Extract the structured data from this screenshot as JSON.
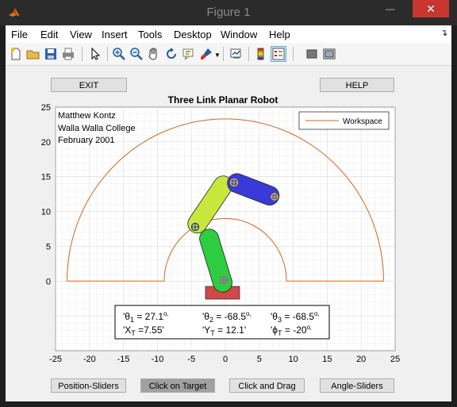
{
  "window": {
    "title": "Figure 1",
    "minimize_glyph": "—",
    "maximize_glyph": "□",
    "close_glyph": "✕"
  },
  "menu": [
    "File",
    "Edit",
    "View",
    "Insert",
    "Tools",
    "Desktop",
    "Window",
    "Help"
  ],
  "toolbar_icons": [
    "new-figure-icon",
    "open-file-icon",
    "save-icon",
    "print-icon",
    "pointer-icon",
    "zoom-in-icon",
    "zoom-out-icon",
    "pan-icon",
    "rotate-icon",
    "data-cursor-icon",
    "brush-icon",
    "link-plot-icon",
    "colorbar-icon",
    "legend-icon",
    "hide-plot-tools-icon",
    "show-plot-tools-icon"
  ],
  "buttons": {
    "exit": "EXIT",
    "help": "HELP",
    "position_sliders": "Position-Sliders",
    "click_on_target": "Click on Target",
    "click_and_drag": "Click and Drag",
    "angle_sliders": "Angle-Sliders"
  },
  "plot": {
    "title": "Three Link Planar Robot",
    "author_lines": [
      "Matthew Kontz",
      "Walla Walla College",
      "February 2001"
    ],
    "legend": "Workspace",
    "xticks": [
      "-25",
      "-20",
      "-15",
      "-10",
      "-5",
      "0",
      "5",
      "10",
      "15",
      "20",
      "25"
    ],
    "yticks": [
      "25",
      "20",
      "15",
      "10",
      "5",
      "0"
    ],
    "xlim": [
      -25,
      25
    ],
    "ylim": [
      -10,
      25
    ]
  },
  "readout": {
    "theta1": {
      "prefix": "'θ",
      "sub": "1",
      "value": " = 27.1",
      "sup": "o",
      "suffix": "'"
    },
    "theta2": {
      "prefix": "'θ",
      "sub": "2",
      "value": " = -68.5",
      "sup": "o",
      "suffix": "'"
    },
    "theta3": {
      "prefix": "'θ",
      "sub": "3",
      "value": " = -68.5",
      "sup": "o",
      "suffix": "'"
    },
    "xt": {
      "prefix": "'X",
      "sub": "T",
      "value": " =7.55'"
    },
    "yt": {
      "prefix": "'Y",
      "sub": "T",
      "value": " = 12.1'"
    },
    "phit": {
      "prefix": "'ϕ",
      "sub": "T",
      "value": " = -20",
      "sup": "o",
      "suffix": "'"
    }
  },
  "colors": {
    "link1": "#2ecc40",
    "link2": "#c8e63c",
    "link3": "#3a3ad8",
    "base": "#d04848",
    "workspace": "#d2691e",
    "close_button": "#c7372f"
  }
}
